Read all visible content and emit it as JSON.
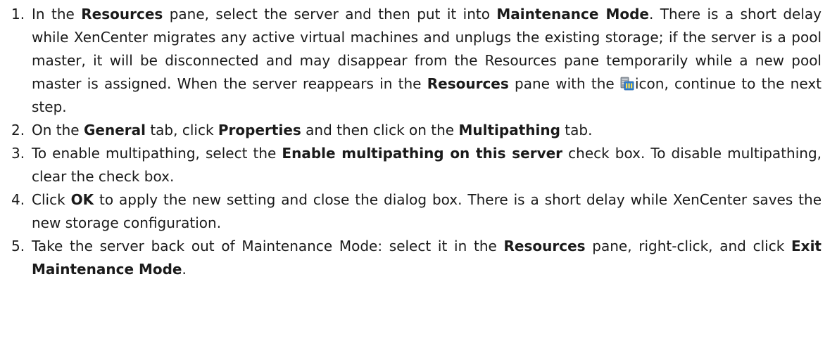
{
  "steps": [
    {
      "number": "1.",
      "parts": [
        {
          "t": "In the "
        },
        {
          "t": "Resources",
          "b": true
        },
        {
          "t": " pane, select the server and then put it into "
        },
        {
          "t": "Maintenance Mode",
          "b": true
        },
        {
          "t": ".  There is a short delay while XenCenter migrates any active virtual machines and unplugs the existing storage; if the server is a pool master, it will be disconnected and may disappear from the Resources pane temporarily while a new pool master is assigned.  When the server reappears in the "
        },
        {
          "t": "Resources",
          "b": true
        },
        {
          "t": " pane with the "
        },
        {
          "icon": "server-maintenance-icon"
        },
        {
          "t": "icon, continue to the next step."
        }
      ]
    },
    {
      "number": "2.",
      "parts": [
        {
          "t": "On the "
        },
        {
          "t": "General",
          "b": true
        },
        {
          "t": " tab, click "
        },
        {
          "t": "Properties",
          "b": true
        },
        {
          "t": " and then click on the "
        },
        {
          "t": "Multipathing",
          "b": true
        },
        {
          "t": " tab."
        }
      ]
    },
    {
      "number": "3.",
      "parts": [
        {
          "t": "To enable multipathing, select the "
        },
        {
          "t": "Enable multipathing on this server",
          "b": true
        },
        {
          "t": " check box.  To disable multipathing, clear the check box."
        }
      ]
    },
    {
      "number": "4.",
      "parts": [
        {
          "t": "Click "
        },
        {
          "t": "OK",
          "b": true
        },
        {
          "t": " to apply the new setting and close the dialog box. There is a short delay while XenCenter saves the new storage configuration."
        }
      ]
    },
    {
      "number": "5.",
      "parts": [
        {
          "t": "Take the server back out of Maintenance Mode: select it in the "
        },
        {
          "t": "Resources",
          "b": true
        },
        {
          "t": " pane, right-click, and click "
        },
        {
          "t": "Exit Maintenance Mode",
          "b": true
        },
        {
          "t": "."
        }
      ]
    }
  ]
}
